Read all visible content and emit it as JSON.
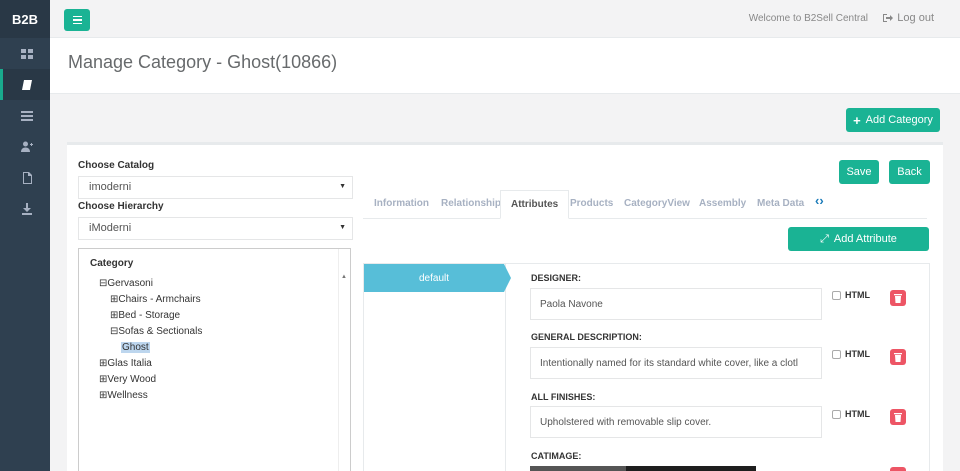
{
  "brand": "B2B",
  "sidebar": {
    "items": [
      {
        "icon": "dashboard-icon",
        "active": false
      },
      {
        "icon": "book-icon",
        "active": true
      },
      {
        "icon": "list-icon",
        "active": false
      },
      {
        "icon": "add-user-icon",
        "active": false
      },
      {
        "icon": "pdf-icon",
        "active": false
      },
      {
        "icon": "download-icon",
        "active": false
      }
    ]
  },
  "topbar": {
    "welcome": "Welcome to B2Sell Central",
    "logout": "Log out"
  },
  "page": {
    "title": "Manage Category - Ghost(10866)",
    "add_category": "Add Category"
  },
  "catalog": {
    "label": "Choose Catalog",
    "value": "imoderni"
  },
  "hierarchy": {
    "label": "Choose Hierarchy",
    "value": "iModerni"
  },
  "tree": {
    "title": "Category",
    "nodes": [
      {
        "toggle": "⊟",
        "label": "Gervasoni"
      },
      {
        "toggle": "⊞",
        "label": "Chairs - Armchairs"
      },
      {
        "toggle": "⊞",
        "label": "Bed - Storage"
      },
      {
        "toggle": "⊟",
        "label": "Sofas & Sectionals"
      },
      {
        "toggle": "",
        "label": "Ghost"
      },
      {
        "toggle": "⊞",
        "label": "Glas Italia"
      },
      {
        "toggle": "⊞",
        "label": "Very Wood"
      },
      {
        "toggle": "⊞",
        "label": "Wellness"
      }
    ]
  },
  "actions": {
    "save": "Save",
    "back": "Back",
    "add_attribute": "Add Attribute"
  },
  "tabs": [
    "Information",
    "Relationship",
    "Attributes",
    "Products",
    "CategoryView",
    "Assembly",
    "Meta Data"
  ],
  "active_tab": "Attributes",
  "attribute_groups": [
    "default"
  ],
  "attributes": [
    {
      "label": "DESIGNER:",
      "value": "Paola Navone",
      "html_label": "HTML"
    },
    {
      "label": "GENERAL DESCRIPTION:",
      "value": "Intentionally named for its standard white cover, like a clotl",
      "html_label": "HTML"
    },
    {
      "label": "ALL FINISHES:",
      "value": "Upholstered with removable slip cover.",
      "html_label": "HTML"
    },
    {
      "label": "CATIMAGE:"
    }
  ],
  "colors": {
    "sidebar": "#2f4050",
    "primary": "#1ab394",
    "info": "#57bed8",
    "danger": "#ed5565"
  }
}
